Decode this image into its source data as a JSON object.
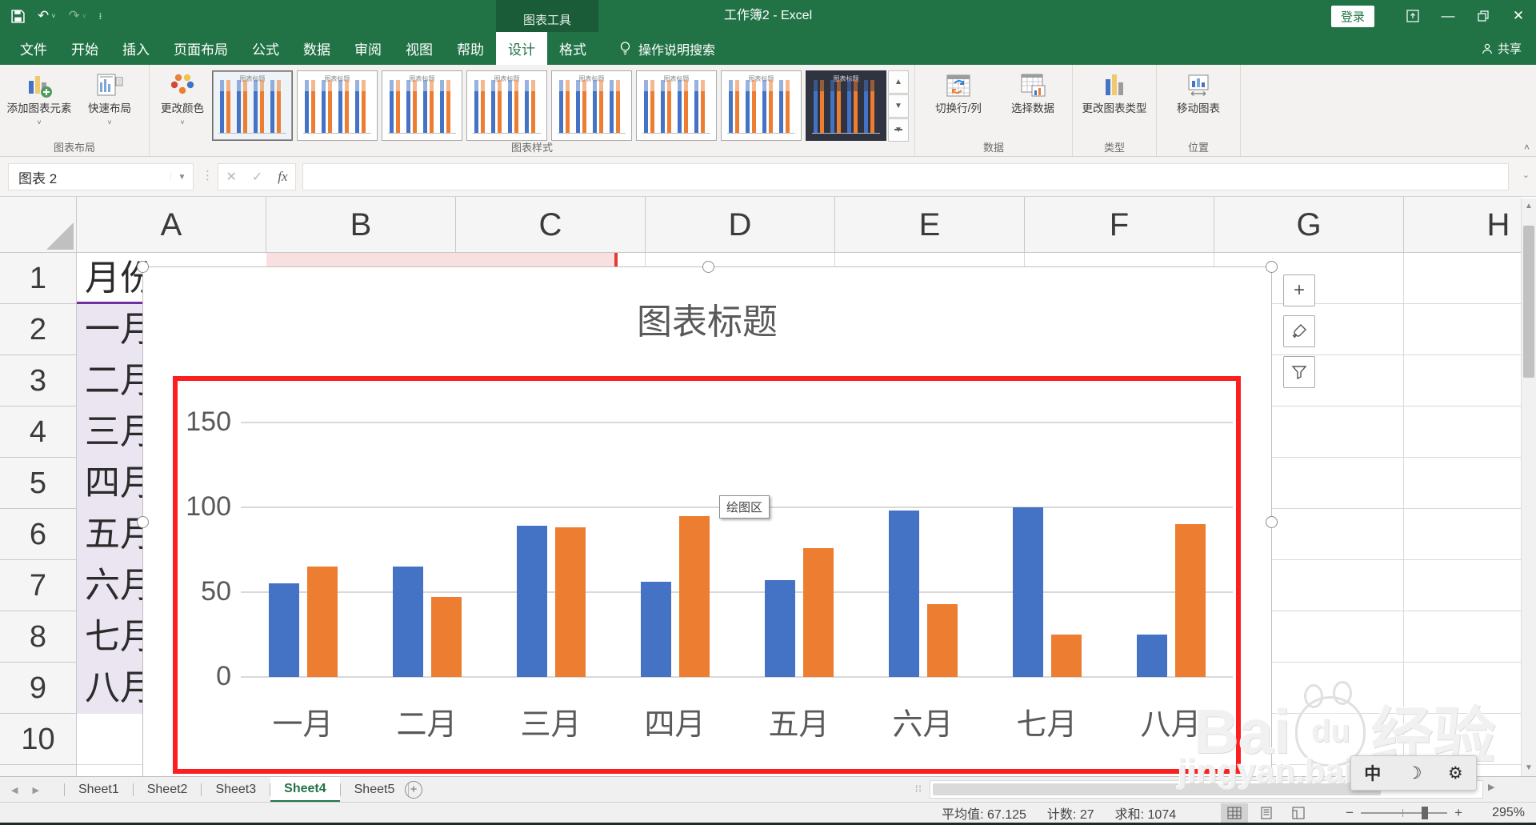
{
  "titlebar": {
    "contextual_label": "图表工具",
    "document_title": "工作簿2 - Excel",
    "signin_label": "登录"
  },
  "tabs": {
    "main": [
      "文件",
      "开始",
      "插入",
      "页面布局",
      "公式",
      "数据",
      "审阅",
      "视图",
      "帮助"
    ],
    "contextual": [
      "设计",
      "格式"
    ],
    "active": "设计",
    "search_label": "操作说明搜索",
    "share_label": "共享"
  },
  "ribbon": {
    "chart_layout": {
      "label": "图表布局",
      "add_element": "添加图表元素",
      "quick_layout": "快速布局"
    },
    "chart_styles": {
      "label": "图表样式",
      "change_colors": "更改颜色",
      "gallery": {
        "count": 8,
        "selected_index": 0,
        "dark_index": 7,
        "preview_title": "图表标题"
      }
    },
    "data_group": {
      "label": "数据",
      "switch_rowcol": "切换行/列",
      "select_data": "选择数据"
    },
    "type_group": {
      "label": "类型",
      "change_type": "更改图表类型"
    },
    "location_group": {
      "label": "位置",
      "move_chart": "移动图表"
    }
  },
  "formula_bar": {
    "name_box": "图表 2",
    "fx_label": "fx",
    "formula_value": ""
  },
  "sheet": {
    "columns": [
      "A",
      "B",
      "C",
      "D",
      "E",
      "F",
      "G",
      "H"
    ],
    "rows": [
      "1",
      "2",
      "3",
      "4",
      "5",
      "6",
      "7",
      "8",
      "9",
      "10"
    ],
    "a_column_cells": [
      "月份",
      "一月",
      "二月",
      "三月",
      "四月",
      "五月",
      "六月",
      "七月",
      "八月"
    ]
  },
  "chart_data": {
    "type": "bar",
    "title": "图表标题",
    "categories": [
      "一月",
      "二月",
      "三月",
      "四月",
      "五月",
      "六月",
      "七月",
      "八月"
    ],
    "series": [
      {
        "name": "blue",
        "color": "#4472C4",
        "values": [
          55,
          65,
          89,
          56,
          57,
          98,
          100,
          25
        ]
      },
      {
        "name": "orange",
        "color": "#ED7D31",
        "values": [
          65,
          47,
          88,
          95,
          76,
          43,
          25,
          90
        ]
      }
    ],
    "ylim": [
      0,
      150
    ],
    "yticks": [
      0,
      50,
      100,
      150
    ],
    "grid": true,
    "legend": "none",
    "plot_highlight_color": "#fb1f1f"
  },
  "plot_tooltip": "绘图区",
  "sheetbar": {
    "tabs": [
      {
        "label": "Sheet1",
        "active": false
      },
      {
        "label": "Sheet2",
        "active": false
      },
      {
        "label": "Sheet3",
        "active": false
      },
      {
        "label": "Sheet4",
        "active": true
      },
      {
        "label": "Sheet5",
        "active": false
      }
    ],
    "add_label": "+"
  },
  "statusbar": {
    "average": "平均值: 67.125",
    "count": "计数: 27",
    "sum": "求和: 1074",
    "zoom_minus": "−",
    "zoom_plus": "+",
    "zoom": "295%"
  },
  "watermark": {
    "brand_prefix": "Bai",
    "brand_mid": "du",
    "brand_cn": "经验",
    "url": "jingyan.baidu.com"
  },
  "ime": {
    "lang": "中",
    "moon": "☽",
    "gear": "⚙"
  }
}
